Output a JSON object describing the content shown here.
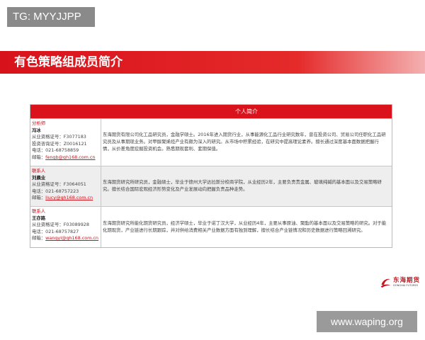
{
  "tg_tag": "TG: MYYJJPP",
  "title": "有色策略组成员简介",
  "table": {
    "header_right": "个人简介",
    "members": [
      {
        "role": "分析师",
        "name": "冯冰",
        "lines": [
          "从业资格证号：F3077183",
          "投资咨询证号：Z0016121",
          "电话：021-68758859"
        ],
        "email_label": "邮箱：",
        "email": "fengb@qh168.com.cn",
        "bio": "东海期货有限公司化工品研究员，金融学硕士。2016年进入期货行业，从事能源化工品行业研究数年，曾在投资公司、贸易公司任职化工品研究员及从事期现业务。对甲醇聚烯烃产业有颇为深入的研究。从市场中积累经验，在研究中提高理论素养。擅长通过深度基本面数据把握行情，从价差角度挖掘投资机会。熟悉期现套利、套期保值。"
      },
      {
        "role": "联系人",
        "name": "刘晨业",
        "lines": [
          "从业资格证号：F3064051",
          "电话：021-68757223"
        ],
        "email_label": "邮箱：",
        "email": "liucy@qh168.com.cn",
        "bio": "东海期货研究所研究员，金融硕士，毕业于德州大学达拉斯分校商学院，从业经历2年，主要负责贵金属、玻璃纯碱的基本面以及交易策略研究。擅长结合国际宏观经济形势变化及产业发展动向把握负责品种走势。"
      },
      {
        "role": "联系人",
        "name": "王亦路",
        "lines": [
          "从业资格证号：F03089928",
          "电话：021-68757827"
        ],
        "email_label": "邮箱：",
        "email": "wangyl@qh168.com.cn",
        "bio": "东海期货研究所能化期货研究员，经济学硕士，毕业于诺丁汉大学，从业经历4年，主要从事原油、聚酯的基本面以及交易策略的研究。对于能化期现货，产业链进行长期跟踪，并对供给消费相关产业数据方面有独到理解，擅长结合产业链情况和历史数据进行策略回溯研究。"
      }
    ]
  },
  "logo": {
    "brand": "东海期货",
    "brand_en": "DONGHAI FUTURES"
  },
  "watermark": "www.waping.org"
}
